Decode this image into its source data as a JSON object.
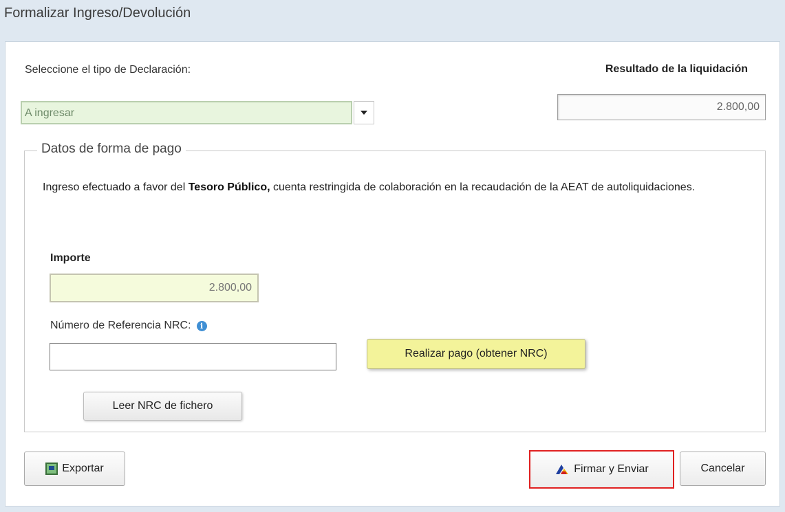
{
  "dialog": {
    "title": "Formalizar Ingreso/Devolución"
  },
  "declaration": {
    "label": "Seleccione el tipo de Declaración:",
    "selected": "A ingresar"
  },
  "result": {
    "label": "Resultado de la liquidación",
    "value": "2.800,00"
  },
  "payment": {
    "legend": "Datos de forma de pago",
    "text_prefix": "Ingreso efectuado a favor del ",
    "text_bold": "Tesoro Público,",
    "text_suffix": " cuenta restringida de colaboración en la recaudación de la AEAT de autoliquidaciones.",
    "importe_label": "Importe",
    "importe_value": "2.800,00",
    "nrc_label": "Número de Referencia  NRC:",
    "nrc_value": "",
    "pay_button": "Realizar pago (obtener NRC)",
    "read_button": "Leer NRC de fichero"
  },
  "footer": {
    "export_button": "Exportar",
    "sign_button": "Firmar y Enviar",
    "cancel_button": "Cancelar"
  },
  "colors": {
    "select_bg": "#e8f5de",
    "importe_bg": "#f5fbdc",
    "pay_button_bg": "#f3f39a",
    "highlight_border": "#e02020",
    "info_icon": "#3f8fd4"
  },
  "icons": {
    "export": "export-icon",
    "sign": "aeat-logo-icon",
    "info": "info-icon",
    "dropdown": "chevron-down-icon"
  }
}
